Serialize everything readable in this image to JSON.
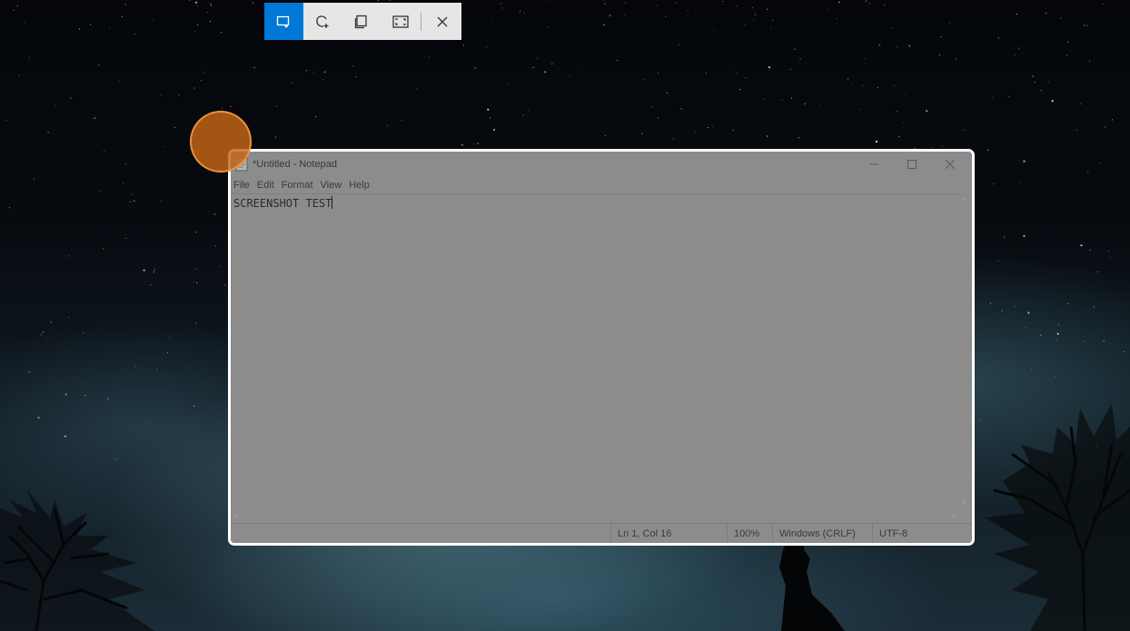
{
  "snip_toolbar": {
    "tools": [
      {
        "name": "rectangular-snip",
        "icon": "rectangle-snip-icon",
        "active": true
      },
      {
        "name": "freeform-snip",
        "icon": "freeform-snip-icon",
        "active": false
      },
      {
        "name": "window-snip",
        "icon": "window-snip-icon",
        "active": false
      },
      {
        "name": "fullscreen-snip",
        "icon": "fullscreen-snip-icon",
        "active": false
      }
    ],
    "close_icon": "close-icon",
    "accent_color": "#0078d7"
  },
  "notepad": {
    "title": "*Untitled - Notepad",
    "menu": [
      "File",
      "Edit",
      "Format",
      "View",
      "Help"
    ],
    "content": "SCREENSHOT TEST",
    "status": {
      "position": "Ln 1, Col 16",
      "zoom": "100%",
      "line_ending": "Windows (CRLF)",
      "encoding": "UTF-8"
    },
    "window_controls": [
      "minimize-icon",
      "maximize-icon",
      "close-icon"
    ]
  },
  "cursor_highlight_color": "#c46616"
}
